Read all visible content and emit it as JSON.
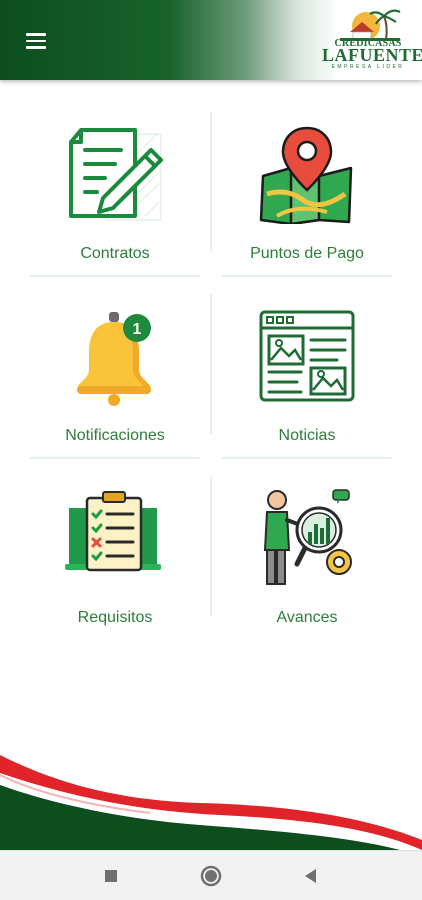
{
  "header": {
    "menu_icon": "hamburger-menu-icon",
    "logo": {
      "line1": "CREDICASAS",
      "line2": "LAFUENTE",
      "line3": "EMPRESA LIDER"
    }
  },
  "menu": {
    "items": [
      {
        "label": "Contratos",
        "icon": "contract-document-icon"
      },
      {
        "label": "Puntos de Pago",
        "icon": "map-location-pin-icon"
      },
      {
        "label": "Notificaciones",
        "icon": "bell-notification-icon",
        "badge": "1"
      },
      {
        "label": "Noticias",
        "icon": "news-webpage-icon"
      },
      {
        "label": "Requisitos",
        "icon": "checklist-clipboard-icon"
      },
      {
        "label": "Avances",
        "icon": "progress-analytics-icon"
      }
    ]
  },
  "colors": {
    "brand_green": "#0d4d1e",
    "label_green": "#2e7d3a",
    "wave_red": "#e0242a",
    "bell_yellow": "#f9c43a"
  },
  "system_nav": {
    "recents_icon": "square-recents-icon",
    "home_icon": "circle-home-icon",
    "back_icon": "triangle-back-icon"
  }
}
